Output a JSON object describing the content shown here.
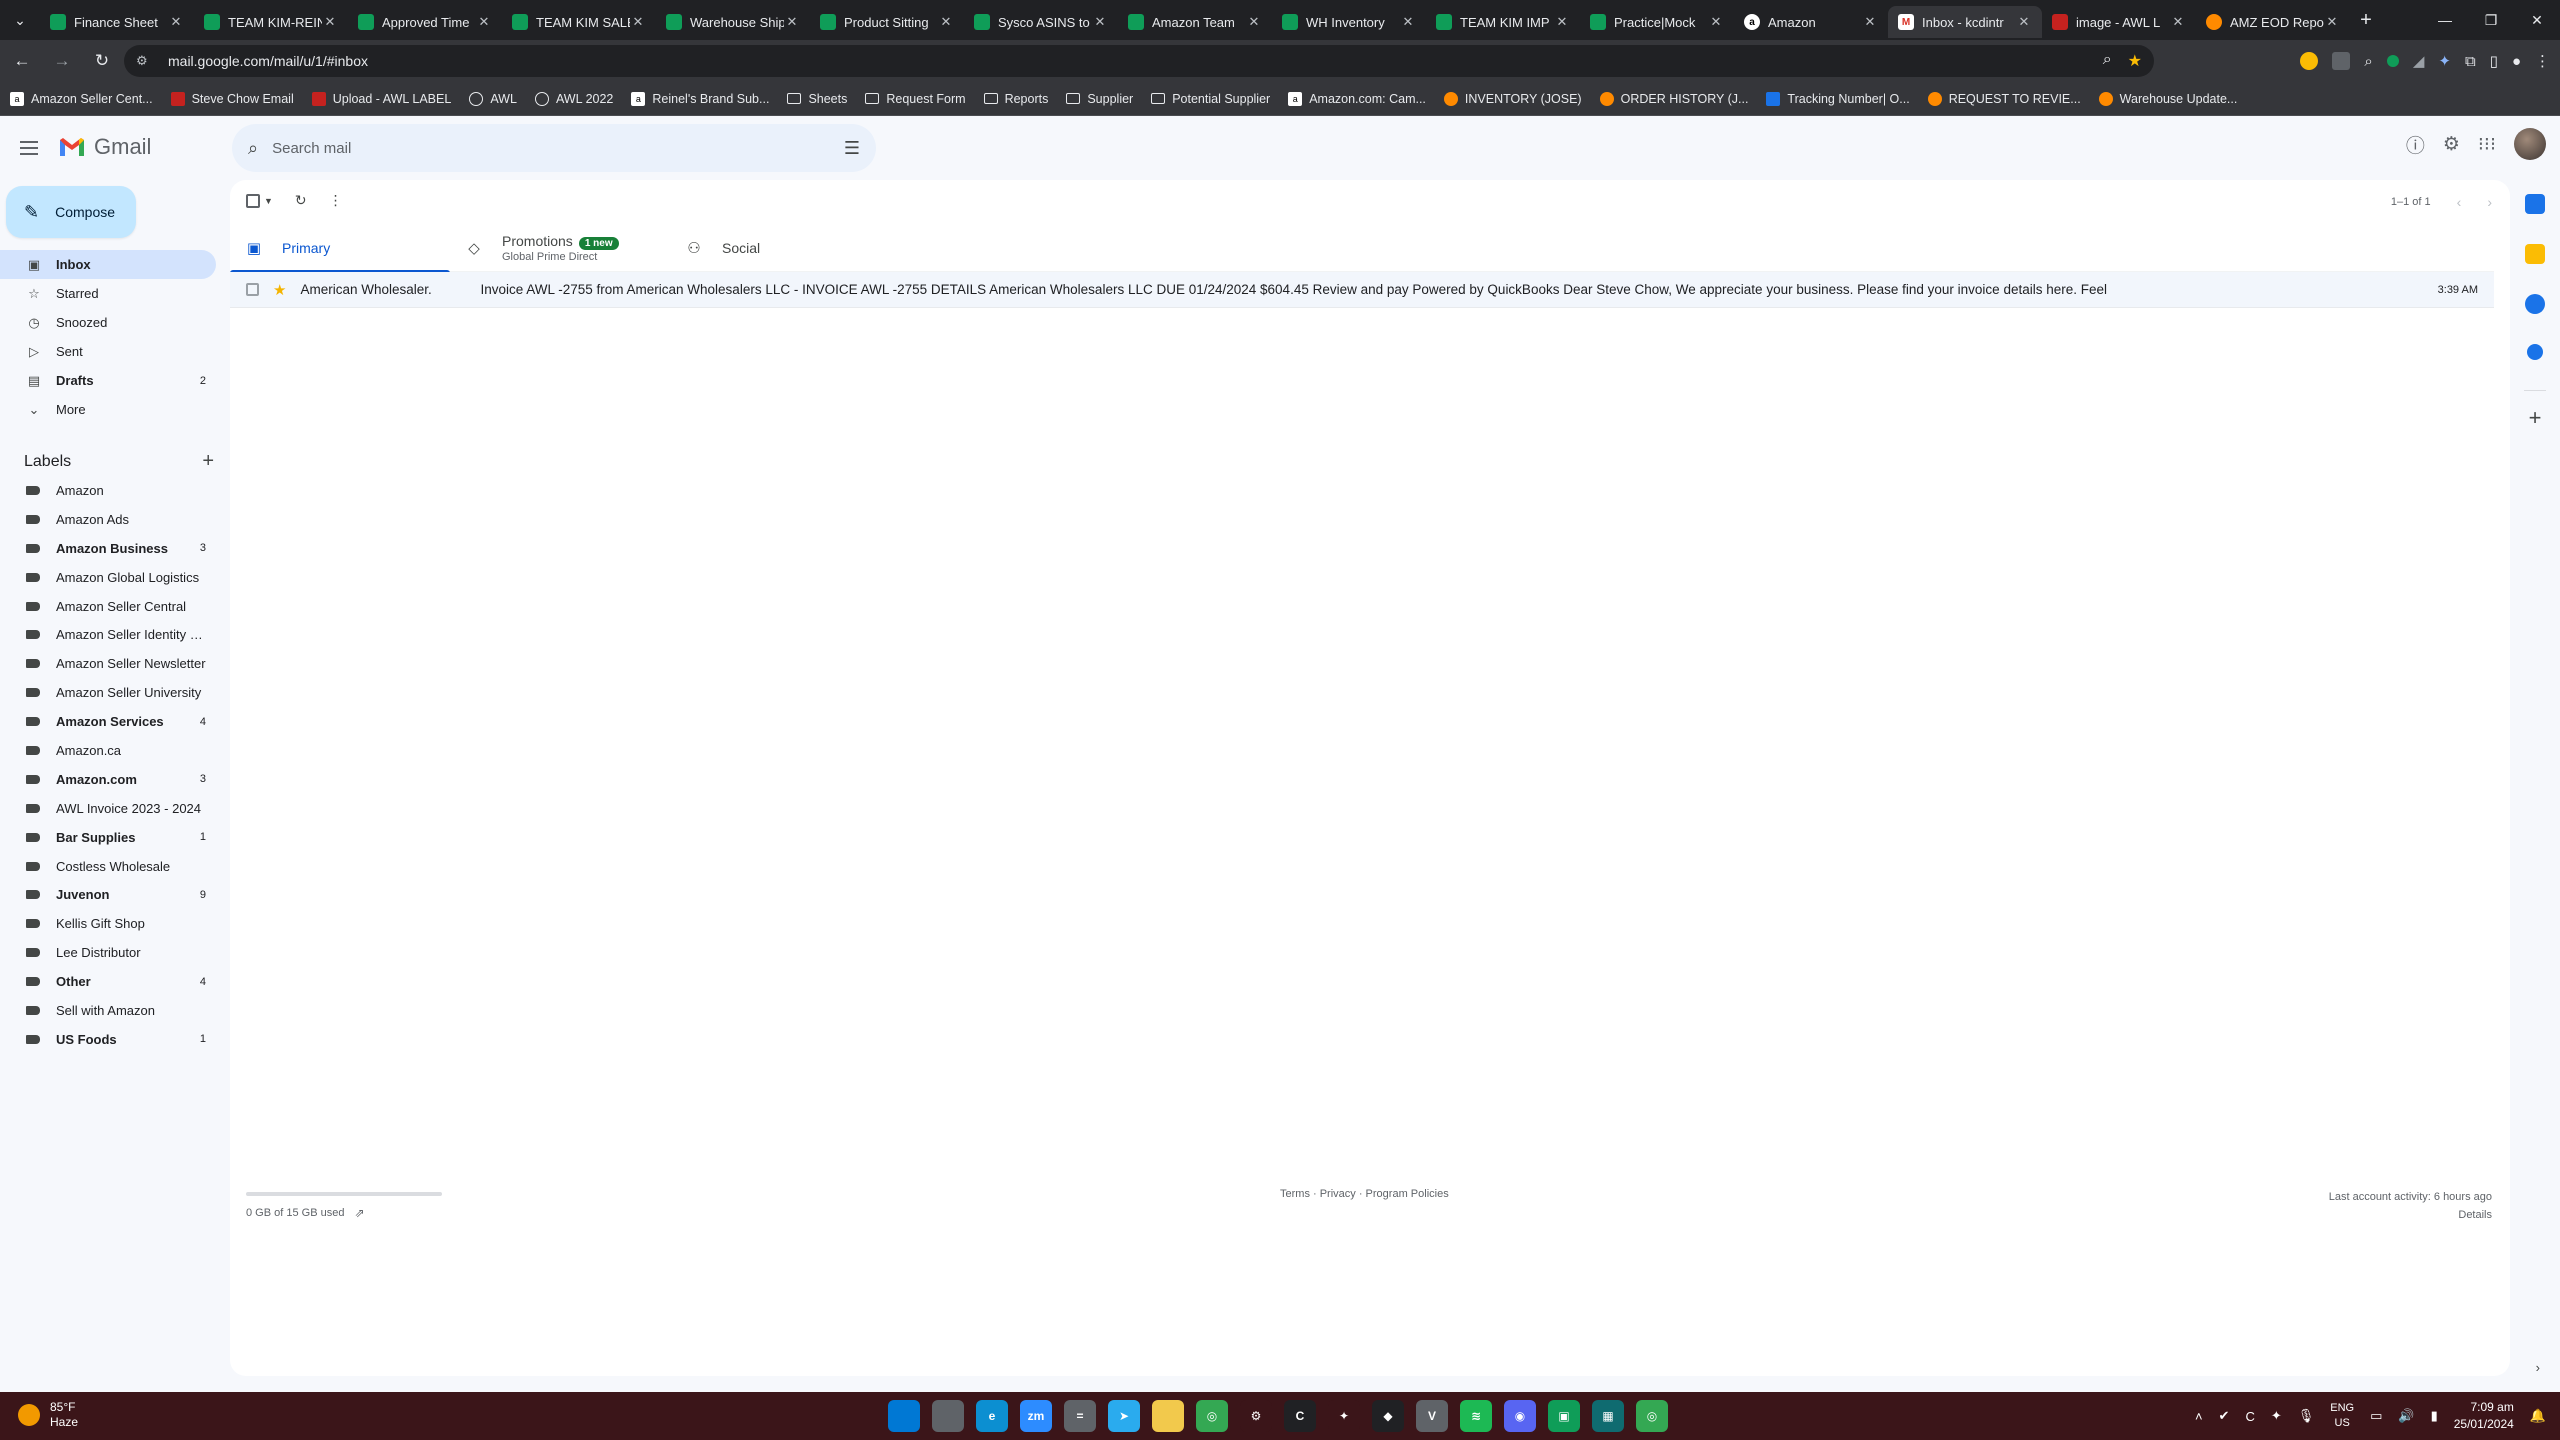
{
  "browser": {
    "tabs": [
      {
        "title": "Finance Sheet",
        "favicon": "sheets-icon",
        "active": false
      },
      {
        "title": "TEAM KIM-REIN",
        "favicon": "sheets-icon",
        "active": false
      },
      {
        "title": "Approved Time",
        "favicon": "sheets-icon",
        "active": false
      },
      {
        "title": "TEAM KIM SALE",
        "favicon": "sheets-icon",
        "active": false
      },
      {
        "title": "Warehouse Ship",
        "favicon": "sheets-icon",
        "active": false
      },
      {
        "title": "Product Sitting",
        "favicon": "sheets-icon",
        "active": false
      },
      {
        "title": "Sysco ASINS to",
        "favicon": "sheets-icon",
        "active": false
      },
      {
        "title": "Amazon Team",
        "favicon": "sheets-icon",
        "active": false
      },
      {
        "title": "WH Inventory",
        "favicon": "sheets-icon",
        "active": false
      },
      {
        "title": "TEAM KIM IMP",
        "favicon": "sheets-icon",
        "active": false
      },
      {
        "title": "Practice|Mock",
        "favicon": "sheets-icon",
        "active": false
      },
      {
        "title": "Amazon",
        "favicon": "amazon-icon",
        "active": false
      },
      {
        "title": "Inbox - kcdintr",
        "favicon": "gmail-icon",
        "active": true
      },
      {
        "title": "image - AWL L",
        "favicon": "red-icon",
        "active": false
      },
      {
        "title": "AMZ EOD Repo",
        "favicon": "orange-icon",
        "active": false
      }
    ],
    "url": "mail.google.com/mail/u/1/#inbox",
    "bookmarks": [
      {
        "label": "Amazon Seller Cent...",
        "icon": "amz"
      },
      {
        "label": "Steve Chow Email",
        "icon": "red"
      },
      {
        "label": "Upload - AWL LABEL",
        "icon": "red"
      },
      {
        "label": "AWL",
        "icon": "globe"
      },
      {
        "label": "AWL 2022",
        "icon": "globe"
      },
      {
        "label": "Reinel's Brand Sub...",
        "icon": "amz"
      },
      {
        "label": "Sheets",
        "icon": "folder"
      },
      {
        "label": "Request Form",
        "icon": "folder"
      },
      {
        "label": "Reports",
        "icon": "folder"
      },
      {
        "label": "Supplier",
        "icon": "folder"
      },
      {
        "label": "Potential Supplier",
        "icon": "folder"
      },
      {
        "label": "Amazon.com: Cam...",
        "icon": "amz"
      },
      {
        "label": "INVENTORY (JOSE)",
        "icon": "orange"
      },
      {
        "label": "ORDER HISTORY (J...",
        "icon": "orange"
      },
      {
        "label": "Tracking Number| O...",
        "icon": "blue"
      },
      {
        "label": "REQUEST TO REVIE...",
        "icon": "orange"
      },
      {
        "label": "Warehouse Update...",
        "icon": "orange"
      }
    ]
  },
  "gmail": {
    "wordmark": "Gmail",
    "search_placeholder": "Search mail",
    "compose_label": "Compose",
    "folders": [
      {
        "label": "Inbox",
        "icon": "inbox-icon",
        "count": "",
        "active": true,
        "bold": true
      },
      {
        "label": "Starred",
        "icon": "star-icon",
        "count": "",
        "active": false,
        "bold": false
      },
      {
        "label": "Snoozed",
        "icon": "clock-icon",
        "count": "",
        "active": false,
        "bold": false
      },
      {
        "label": "Sent",
        "icon": "send-icon",
        "count": "",
        "active": false,
        "bold": false
      },
      {
        "label": "Drafts",
        "icon": "draft-icon",
        "count": "2",
        "active": false,
        "bold": true
      },
      {
        "label": "More",
        "icon": "chevron-down-icon",
        "count": "",
        "active": false,
        "bold": false
      }
    ],
    "labels_heading": "Labels",
    "labels": [
      {
        "label": "Amazon",
        "count": "",
        "bold": false
      },
      {
        "label": "Amazon Ads",
        "count": "",
        "bold": false
      },
      {
        "label": "Amazon Business",
        "count": "3",
        "bold": true
      },
      {
        "label": "Amazon Global Logistics",
        "count": "",
        "bold": false
      },
      {
        "label": "Amazon Seller Central",
        "count": "",
        "bold": false
      },
      {
        "label": "Amazon Seller Identity V...",
        "count": "",
        "bold": false
      },
      {
        "label": "Amazon Seller Newsletter",
        "count": "",
        "bold": false
      },
      {
        "label": "Amazon Seller University",
        "count": "",
        "bold": false
      },
      {
        "label": "Amazon Services",
        "count": "4",
        "bold": true
      },
      {
        "label": "Amazon.ca",
        "count": "",
        "bold": false
      },
      {
        "label": "Amazon.com",
        "count": "3",
        "bold": true
      },
      {
        "label": "AWL Invoice 2023 - 2024",
        "count": "",
        "bold": false
      },
      {
        "label": "Bar Supplies",
        "count": "1",
        "bold": true
      },
      {
        "label": "Costless Wholesale",
        "count": "",
        "bold": false
      },
      {
        "label": "Juvenon",
        "count": "9",
        "bold": true
      },
      {
        "label": "Kellis Gift Shop",
        "count": "",
        "bold": false
      },
      {
        "label": "Lee Distributor",
        "count": "",
        "bold": false
      },
      {
        "label": "Other",
        "count": "4",
        "bold": true
      },
      {
        "label": "Sell with Amazon",
        "count": "",
        "bold": false
      },
      {
        "label": "US Foods",
        "count": "1",
        "bold": true
      }
    ],
    "pagination": "1–1 of 1",
    "category_tabs": [
      {
        "label": "Primary",
        "sub": "",
        "badge": "",
        "icon": "inbox-icon",
        "active": true
      },
      {
        "label": "Promotions",
        "sub": "Global Prime Direct",
        "badge": "1 new",
        "icon": "tag-icon",
        "active": false
      },
      {
        "label": "Social",
        "sub": "",
        "badge": "",
        "icon": "people-icon",
        "active": false
      }
    ],
    "emails": [
      {
        "sender": "American Wholesaler.",
        "subject": "Invoice AWL -2755 from American Wholesalers LLC - INVOICE AWL -2755 DETAILS American Wholesalers LLC DUE 01/24/2024 $604.45 Review and pay Powered by QuickBooks Dear Steve Chow, We appreciate your business. Please find your invoice details here. Feel",
        "time": "3:39 AM",
        "starred": true
      }
    ],
    "storage": "0 GB of 15 GB used",
    "storage_fraction": 0.0,
    "footer_links": "Terms · Privacy · Program Policies",
    "last_activity": "Last account activity: 6 hours ago",
    "details_link": "Details"
  },
  "taskbar": {
    "temperature": "85°F",
    "condition": "Haze",
    "apps": [
      {
        "name": "windows-start-icon",
        "color": "#0078d4",
        "text": ""
      },
      {
        "name": "task-view-icon",
        "color": "#5f6368",
        "text": ""
      },
      {
        "name": "edge-icon",
        "color": "#0c8fd1",
        "text": "e"
      },
      {
        "name": "zoom-icon",
        "color": "#2d8cff",
        "text": "zm"
      },
      {
        "name": "calculator-icon",
        "color": "#5f6368",
        "text": "="
      },
      {
        "name": "telegram-icon",
        "color": "#2aabee",
        "text": "➤"
      },
      {
        "name": "file-explorer-icon",
        "color": "#f2c94c",
        "text": ""
      },
      {
        "name": "chrome-icon",
        "color": "#34a853",
        "text": "◎"
      },
      {
        "name": "settings-app-icon",
        "color": "#3b1519",
        "text": "⚙"
      },
      {
        "name": "app-icon-c",
        "color": "#202124",
        "text": "C"
      },
      {
        "name": "app-icon-star",
        "color": "#3b1519",
        "text": "✦"
      },
      {
        "name": "binance-icon",
        "color": "#202124",
        "text": "◆"
      },
      {
        "name": "app-icon-v",
        "color": "#5f6368",
        "text": "V"
      },
      {
        "name": "spotify-icon",
        "color": "#1db954",
        "text": "≋"
      },
      {
        "name": "discord-icon",
        "color": "#5865f2",
        "text": "◉"
      },
      {
        "name": "app-icon-green",
        "color": "#0f9d58",
        "text": "▣"
      },
      {
        "name": "app-icon-teal",
        "color": "#0f6b70",
        "text": "▦"
      },
      {
        "name": "chrome-active-icon",
        "color": "#34a853",
        "text": "◎"
      }
    ],
    "language": "ENG",
    "region": "US",
    "time": "7:09 am",
    "date": "25/01/2024"
  }
}
